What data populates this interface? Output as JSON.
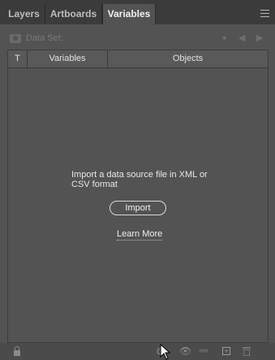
{
  "tabs": [
    {
      "label": "Layers",
      "active": false
    },
    {
      "label": "Artboards",
      "active": false
    },
    {
      "label": "Variables",
      "active": true
    }
  ],
  "toolbar": {
    "dataset_label": "Data Set:"
  },
  "table": {
    "columns": [
      "T",
      "Variables",
      "Objects"
    ]
  },
  "empty_state": {
    "message": "Import a data source file in XML or CSV format",
    "import_label": "Import",
    "learn_more_label": "Learn More"
  },
  "icons": {
    "menu": "hamburger-menu-icon",
    "camera": "camera-icon",
    "lock": "lock-icon",
    "gear": "bind-gear-icon",
    "eye": "eye-icon",
    "unlink": "unbind-icon",
    "new": "new-variable-icon",
    "trash": "trash-icon"
  },
  "colors": {
    "panel_bg": "#535353",
    "tabbar_bg": "#3b3b3b",
    "text": "#d6d6d6"
  }
}
